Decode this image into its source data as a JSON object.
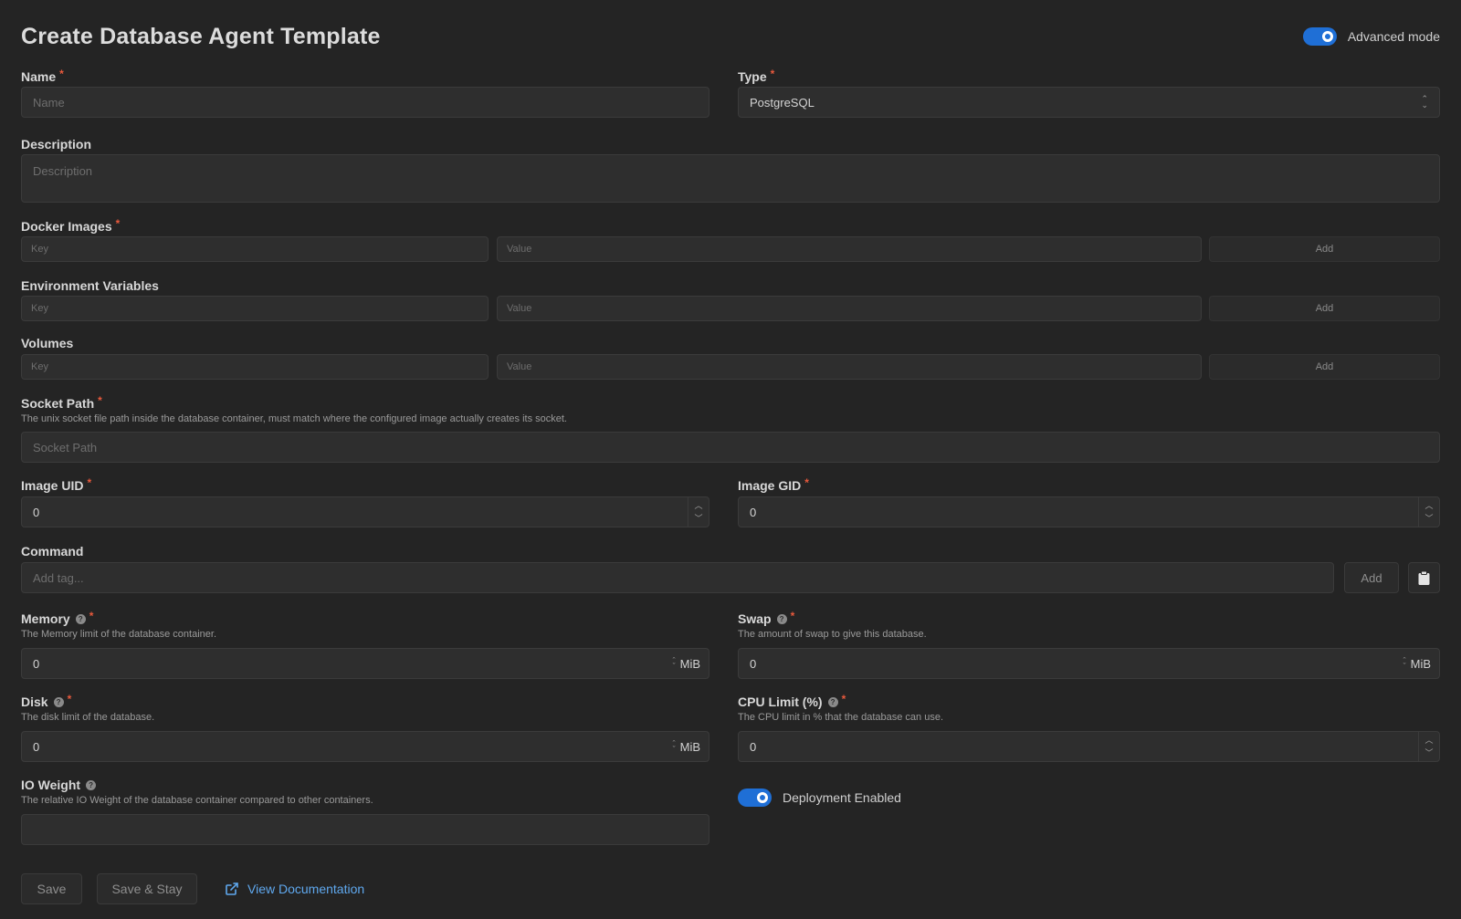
{
  "header": {
    "title": "Create Database Agent Template",
    "advanced_mode_label": "Advanced mode",
    "advanced_mode_on": true
  },
  "colors": {
    "accent": "#1f6fd6",
    "required": "#e8593c",
    "link": "#5fa8ee",
    "background": "#242424"
  },
  "name": {
    "label": "Name",
    "placeholder": "Name",
    "value": ""
  },
  "type": {
    "label": "Type",
    "value": "PostgreSQL"
  },
  "description": {
    "label": "Description",
    "placeholder": "Description"
  },
  "docker_images": {
    "label": "Docker Images",
    "key_placeholder": "Key",
    "value_placeholder": "Value",
    "add_label": "Add"
  },
  "environment_variables": {
    "label": "Environment Variables",
    "key_placeholder": "Key",
    "value_placeholder": "Value",
    "add_label": "Add"
  },
  "volumes": {
    "label": "Volumes",
    "key_placeholder": "Key",
    "value_placeholder": "Value",
    "add_label": "Add"
  },
  "socket_path": {
    "label": "Socket Path",
    "description": "The unix socket file path inside the database container, must match where the configured image actually creates its socket.",
    "placeholder": "Socket Path"
  },
  "image_uid": {
    "label": "Image UID",
    "value": "0"
  },
  "image_gid": {
    "label": "Image GID",
    "value": "0"
  },
  "command": {
    "label": "Command",
    "placeholder": "Add tag...",
    "add_label": "Add"
  },
  "memory": {
    "label": "Memory",
    "description": "The Memory limit of the database container.",
    "value": "0",
    "unit": "MiB"
  },
  "swap": {
    "label": "Swap",
    "description": "The amount of swap to give this database.",
    "value": "0",
    "unit": "MiB"
  },
  "disk": {
    "label": "Disk",
    "description": "The disk limit of the database.",
    "value": "0",
    "unit": "MiB"
  },
  "cpu_limit": {
    "label": "CPU Limit (%)",
    "description": "The CPU limit in % that the database can use.",
    "value": "0"
  },
  "io_weight": {
    "label": "IO Weight",
    "description": "The relative IO Weight of the database container compared to other containers.",
    "value": ""
  },
  "deployment": {
    "label": "Deployment Enabled",
    "enabled": true
  },
  "actions": {
    "save_label": "Save",
    "save_stay_label": "Save & Stay",
    "docs_label": "View Documentation"
  }
}
